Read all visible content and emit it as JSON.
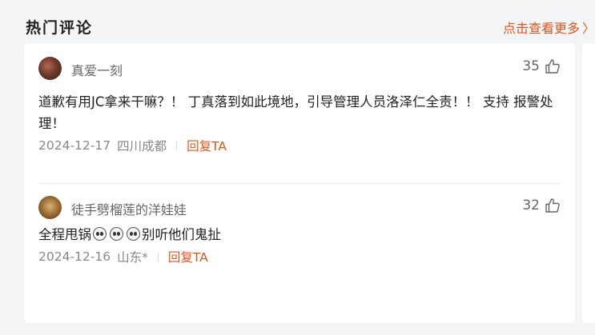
{
  "header": {
    "title": "热门评论",
    "more_label": "点击查看更多",
    "more_icon": "chevron-right-icon"
  },
  "comments": [
    {
      "user": "真爱一刻",
      "likes": "35",
      "text": "道歉有用JC拿来干嘛？！ 丁真落到如此境地，引导管理人员洛泽仁全责！！ 支持 报警处理！",
      "date": "2024-12-17",
      "location": "四川成都",
      "reply_label": "回复TA"
    },
    {
      "user": "徒手劈榴莲的洋娃娃",
      "likes": "32",
      "text_before": "全程甩锅",
      "text_after": "别听他们鬼扯",
      "date": "2024-12-16",
      "location": "山东*",
      "reply_label": "回复TA"
    }
  ],
  "colors": {
    "accent": "#e0561e",
    "background": "#f4f5f7",
    "card": "#ffffff"
  }
}
